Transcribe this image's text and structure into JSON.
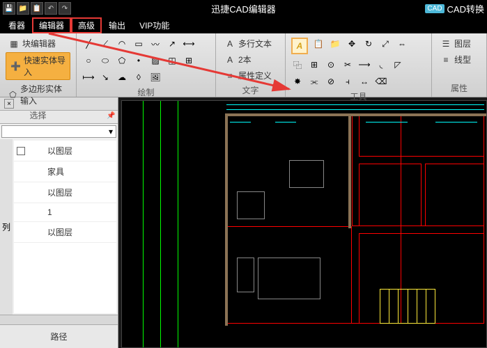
{
  "titlebar": {
    "title": "迅捷CAD编辑器",
    "cad_badge": "CAD",
    "cad_convert": "CAD转换"
  },
  "menubar": {
    "items": [
      "看器",
      "编辑器",
      "高级",
      "输出",
      "VIP功能"
    ]
  },
  "ribbon": {
    "groups": [
      {
        "label": "选择",
        "buttons": [
          {
            "icon": "block-editor-icon",
            "label": "块编辑器"
          },
          {
            "icon": "plus-icon",
            "label": "快速实体导入"
          },
          {
            "icon": "polygon-icon",
            "label": "多边形实体输入"
          }
        ]
      },
      {
        "label": "绘制"
      },
      {
        "label": "文字",
        "buttons": [
          {
            "icon": "mtext-icon",
            "label": "多行文本"
          },
          {
            "icon": "text-icon",
            "label": "2本"
          },
          {
            "icon": "attdef-icon",
            "label": "属性定义"
          }
        ]
      },
      {
        "label": "工具"
      },
      {
        "label": "属性",
        "buttons": [
          {
            "icon": "layer-icon",
            "label": "图层"
          },
          {
            "icon": "linetype-icon",
            "label": "线型"
          }
        ]
      }
    ]
  },
  "panel": {
    "rows": [
      {
        "check": true,
        "label": "以图层"
      },
      {
        "check": false,
        "label": "家具"
      },
      {
        "check": false,
        "label": "以图层"
      },
      {
        "check": false,
        "label": "1"
      },
      {
        "check": false,
        "label": "以图层"
      }
    ],
    "side_label": "列",
    "footer": "路径"
  }
}
